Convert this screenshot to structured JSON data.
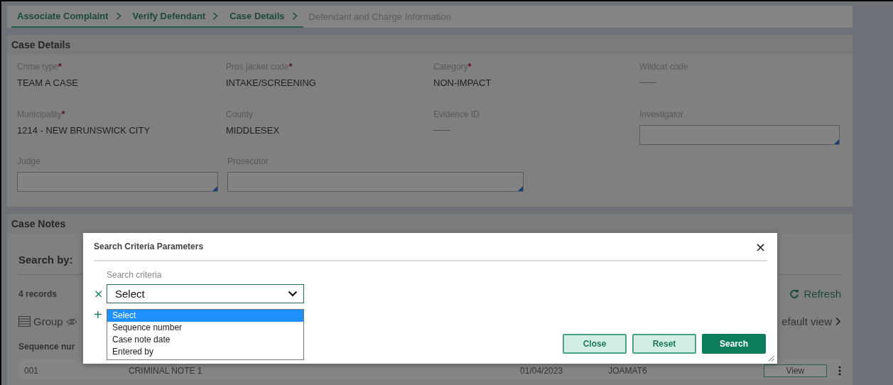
{
  "breadcrumb": [
    {
      "label": "Associate Complaint",
      "completed": true
    },
    {
      "label": "Verify Defendant",
      "completed": true
    },
    {
      "label": "Case Details",
      "completed": true
    },
    {
      "label": "Defendant and Charge Information",
      "completed": false
    }
  ],
  "case_details": {
    "title": "Case Details",
    "required_mark": "*",
    "fields": [
      {
        "label": "Crime type",
        "required": true,
        "kind": "value",
        "value": "TEAM A CASE"
      },
      {
        "label": "Pros jacket code",
        "required": true,
        "kind": "value",
        "value": "INTAKE/SCREENING"
      },
      {
        "label": "Category",
        "required": true,
        "kind": "value",
        "value": "NON-IMPACT"
      },
      {
        "label": "Wildcat code",
        "required": false,
        "kind": "empty",
        "value": "——"
      },
      {
        "label": "Municipality",
        "required": true,
        "kind": "value",
        "value": "1214 - NEW BRUNSWICK CITY"
      },
      {
        "label": "County",
        "required": false,
        "kind": "value",
        "value": "MIDDLESEX"
      },
      {
        "label": "Evidence ID",
        "required": false,
        "kind": "empty",
        "value": "——"
      },
      {
        "label": "Investigator",
        "required": false,
        "kind": "input"
      },
      {
        "label": "Judge",
        "required": false,
        "kind": "input"
      },
      {
        "label": "Prosecutor",
        "required": false,
        "kind": "input"
      }
    ]
  },
  "case_notes": {
    "title": "Case Notes",
    "search_by": "Search by:",
    "records": "4 records",
    "group": "Group",
    "refresh": "Refresh",
    "view_menu": "efault view",
    "column": "Sequence nur",
    "rows": [
      {
        "cells": [
          "001",
          "CRIMINAL NOTE 1",
          "01/04/2023",
          "JOAMAT6"
        ],
        "action": "View"
      }
    ]
  },
  "modal": {
    "title": "Search Criteria Parameters",
    "close": "×",
    "criteria_label": "Search criteria",
    "remove": "×",
    "add": "+",
    "select_value": "Select",
    "options": [
      {
        "label": "Select",
        "selected": true
      },
      {
        "label": "Sequence number",
        "selected": false
      },
      {
        "label": "Case note date",
        "selected": false
      },
      {
        "label": "Entered by",
        "selected": false
      }
    ],
    "buttons": [
      {
        "label": "Close",
        "kind": "secondary"
      },
      {
        "label": "Reset",
        "kind": "secondary"
      },
      {
        "label": "Search",
        "kind": "primary"
      }
    ]
  }
}
